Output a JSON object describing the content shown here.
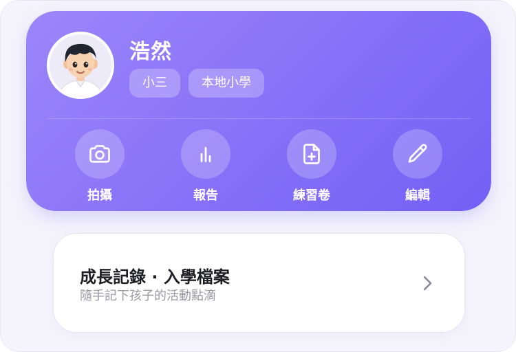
{
  "profile": {
    "name": "浩然",
    "chips": [
      "小三",
      "本地小學"
    ],
    "actions": [
      {
        "label": "拍攝",
        "icon": "camera-icon"
      },
      {
        "label": "報告",
        "icon": "bar-chart-icon"
      },
      {
        "label": "練習卷",
        "icon": "file-plus-icon"
      },
      {
        "label": "編輯",
        "icon": "pencil-icon"
      }
    ]
  },
  "record": {
    "title": "成長記錄 · 入學檔案",
    "subtitle": "隨手記下孩子的活動點滴"
  },
  "colors": {
    "accent_start": "#9b86fb",
    "accent_end": "#745ff5",
    "background": "#f5f4fc"
  }
}
